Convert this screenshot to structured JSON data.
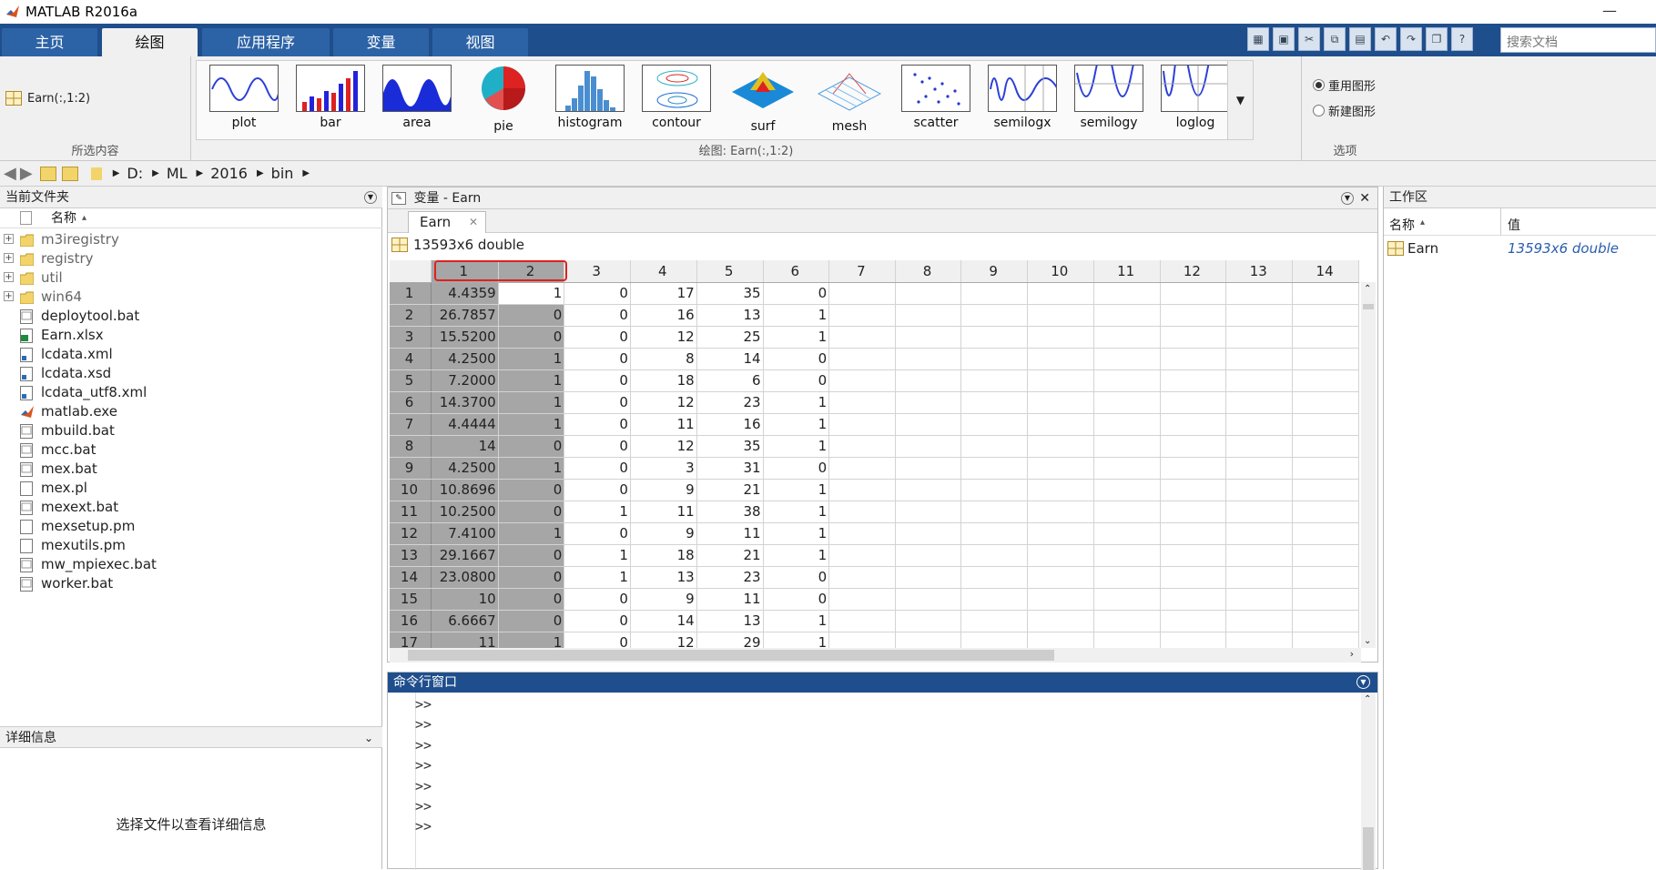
{
  "window": {
    "title": "MATLAB R2016a",
    "min_glyph": "—"
  },
  "tabs": [
    "主页",
    "绘图",
    "应用程序",
    "变量",
    "视图"
  ],
  "search": {
    "placeholder": "搜索文档"
  },
  "ribbon": {
    "selection_label": "Earn(:,1:2)",
    "section_selection": "所选内容",
    "section_plots": "绘图: Earn(:,1:2)",
    "section_options": "选项",
    "options": [
      "重用图形",
      "新建图形"
    ],
    "plots": [
      "plot",
      "bar",
      "area",
      "pie",
      "histogram",
      "contour",
      "surf",
      "mesh",
      "scatter",
      "semilogx",
      "semilogy",
      "loglog"
    ]
  },
  "address": {
    "drive": "D:",
    "path": [
      "ML",
      "2016",
      "bin"
    ]
  },
  "current_folder": {
    "title": "当前文件夹",
    "column": "名称",
    "sort_glyph": "▴",
    "expand_glyph": "+",
    "items": [
      {
        "name": "m3iregistry",
        "type": "folder"
      },
      {
        "name": "registry",
        "type": "folder"
      },
      {
        "name": "util",
        "type": "folder"
      },
      {
        "name": "win64",
        "type": "folder"
      },
      {
        "name": "deploytool.bat",
        "type": "bat"
      },
      {
        "name": "Earn.xlsx",
        "type": "xlsx"
      },
      {
        "name": "lcdata.xml",
        "type": "xml"
      },
      {
        "name": "lcdata.xsd",
        "type": "xml"
      },
      {
        "name": "lcdata_utf8.xml",
        "type": "xml"
      },
      {
        "name": "matlab.exe",
        "type": "exe"
      },
      {
        "name": "mbuild.bat",
        "type": "bat"
      },
      {
        "name": "mcc.bat",
        "type": "bat"
      },
      {
        "name": "mex.bat",
        "type": "bat"
      },
      {
        "name": "mex.pl",
        "type": "file"
      },
      {
        "name": "mexext.bat",
        "type": "bat"
      },
      {
        "name": "mexsetup.pm",
        "type": "file"
      },
      {
        "name": "mexutils.pm",
        "type": "file"
      },
      {
        "name": "mw_mpiexec.bat",
        "type": "bat"
      },
      {
        "name": "worker.bat",
        "type": "bat"
      }
    ]
  },
  "details": {
    "title": "详细信息",
    "message": "选择文件以查看详细信息"
  },
  "variables": {
    "title": "变量 - Earn",
    "tab": "Earn",
    "tab_close": "✕",
    "size": "13593x6 double",
    "columns": [
      "1",
      "2",
      "3",
      "4",
      "5",
      "6",
      "7",
      "8",
      "9",
      "10",
      "11",
      "12",
      "13",
      "14"
    ],
    "rows": [
      [
        "1",
        "4.4359",
        "1",
        "0",
        "17",
        "35",
        "0"
      ],
      [
        "2",
        "26.7857",
        "0",
        "0",
        "16",
        "13",
        "1"
      ],
      [
        "3",
        "15.5200",
        "0",
        "0",
        "12",
        "25",
        "1"
      ],
      [
        "4",
        "4.2500",
        "1",
        "0",
        "8",
        "14",
        "0"
      ],
      [
        "5",
        "7.2000",
        "1",
        "0",
        "18",
        "6",
        "0"
      ],
      [
        "6",
        "14.3700",
        "1",
        "0",
        "12",
        "23",
        "1"
      ],
      [
        "7",
        "4.4444",
        "1",
        "0",
        "11",
        "16",
        "1"
      ],
      [
        "8",
        "14",
        "0",
        "0",
        "12",
        "35",
        "1"
      ],
      [
        "9",
        "4.2500",
        "1",
        "0",
        "3",
        "31",
        "0"
      ],
      [
        "10",
        "10.8696",
        "0",
        "0",
        "9",
        "21",
        "1"
      ],
      [
        "11",
        "10.2500",
        "0",
        "1",
        "11",
        "38",
        "1"
      ],
      [
        "12",
        "7.4100",
        "1",
        "0",
        "9",
        "11",
        "1"
      ],
      [
        "13",
        "29.1667",
        "0",
        "1",
        "18",
        "21",
        "1"
      ],
      [
        "14",
        "23.0800",
        "0",
        "1",
        "13",
        "23",
        "0"
      ],
      [
        "15",
        "10",
        "0",
        "0",
        "9",
        "11",
        "0"
      ],
      [
        "16",
        "6.6667",
        "0",
        "0",
        "14",
        "13",
        "1"
      ],
      [
        "17",
        "11",
        "1",
        "0",
        "12",
        "29",
        "1"
      ]
    ]
  },
  "command_window": {
    "title": "命令行窗口",
    "prompt": ">>",
    "prompt_count": 7
  },
  "workspace": {
    "title": "工作区",
    "col_name": "名称",
    "col_value": "值",
    "items": [
      {
        "name": "Earn",
        "value": "13593x6 double"
      }
    ]
  },
  "colors": {
    "tabbar": "#1f4e8c",
    "selection": "#a6a6a6",
    "highlight": "#e02020",
    "cmd_header": "#1f4e8c",
    "ws_value": "#2a5db0"
  }
}
